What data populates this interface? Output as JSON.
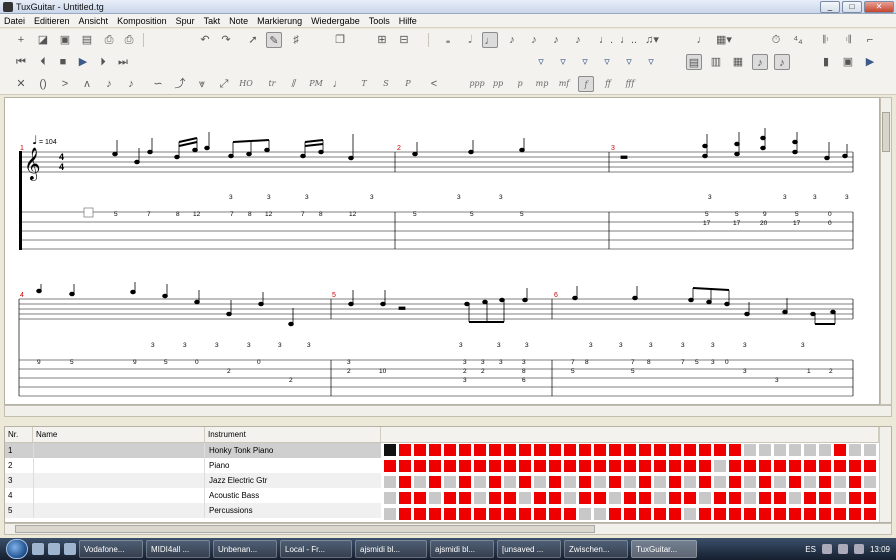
{
  "window": {
    "title": "TuxGuitar - Untitled.tg",
    "buttons": [
      "_",
      "□",
      "✕"
    ]
  },
  "menu": [
    "Datei",
    "Editieren",
    "Ansicht",
    "Komposition",
    "Spur",
    "Takt",
    "Note",
    "Markierung",
    "Wiedergabe",
    "Tools",
    "Hilfe"
  ],
  "toolbar": {
    "dynamics": [
      "ppp",
      "pp",
      "p",
      "mp",
      "mf",
      "f",
      "ff",
      "fff"
    ],
    "effects": [
      "tr",
      "PM",
      "T",
      "S",
      "P"
    ]
  },
  "score": {
    "tempo": "= 104",
    "time_signature": [
      "4",
      "4"
    ],
    "measure_numbers": [
      "1",
      "2",
      "3",
      "4",
      "5",
      "6"
    ],
    "system1": {
      "triplets": [
        "3",
        "3",
        "3",
        "3",
        "3",
        "3",
        "3",
        "3",
        "3",
        "3"
      ],
      "tab_string1": [
        "5",
        "7",
        "8",
        "12",
        "7",
        "8",
        "12",
        "7",
        "8",
        "12",
        "5",
        "5",
        "5",
        "5",
        "5",
        "9",
        "5",
        "0"
      ],
      "tab_string2": [
        "17",
        "17",
        "20",
        "17",
        "0"
      ]
    },
    "system2": {
      "triplets": [
        "3",
        "3",
        "3",
        "3",
        "3",
        "3",
        "3",
        "3",
        "3",
        "3",
        "3",
        "3",
        "3",
        "3",
        "3",
        "3"
      ],
      "tab_string1": [
        "9",
        "5",
        "9",
        "5",
        "0",
        "3",
        "3",
        "3",
        "3",
        "3",
        "7",
        "8",
        "7",
        "8",
        "7",
        "5",
        "3",
        "0"
      ],
      "tab_string2": [
        "2",
        "0",
        "2",
        "10",
        "2",
        "2",
        "8",
        "5",
        "5",
        "3",
        "1",
        "2"
      ],
      "tab_string3": [
        "2",
        "3",
        "3",
        "6"
      ]
    }
  },
  "tracks": {
    "columns": [
      "Nr.",
      "Name",
      "Instrument"
    ],
    "rows": [
      {
        "nr": "1",
        "name": "",
        "instrument": "Honky Tonk Piano"
      },
      {
        "nr": "2",
        "name": "",
        "instrument": "Piano"
      },
      {
        "nr": "3",
        "name": "",
        "instrument": "Jazz Electric Gtr"
      },
      {
        "nr": "4",
        "name": "",
        "instrument": "Acoustic Bass"
      },
      {
        "nr": "5",
        "name": "",
        "instrument": "Percussions"
      }
    ],
    "colors": {
      "filled": "#ee0000",
      "empty": "#c8c8c8",
      "selected": "#111111"
    }
  },
  "taskbar": {
    "tasks": [
      "Vodafone...",
      "MIDI4all ...",
      "Unbenan...",
      "Local - Fr...",
      "ajsmidi bl...",
      "ajsmidi bl...",
      "[unsaved ...",
      "Zwischen...",
      "TuxGuitar..."
    ],
    "lang": "ES",
    "time": "13:09"
  }
}
